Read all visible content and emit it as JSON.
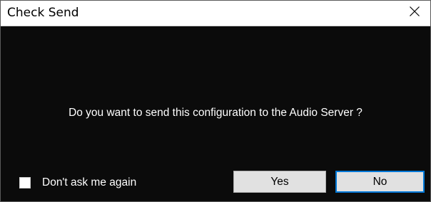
{
  "dialog": {
    "title": "Check Send",
    "close_icon": "close-icon",
    "message": "Do you want to send this configuration to the Audio Server ?",
    "dont_ask_again": {
      "label": "Don't ask me again",
      "checked": false
    },
    "buttons": {
      "yes_label": "Yes",
      "no_label": "No",
      "default": "No"
    }
  },
  "colors": {
    "title_bar": "#ffffff",
    "body_background": "#0b0b0b",
    "text_on_body": "#ffffff",
    "button_face": "#e1e1e1",
    "default_button_border": "#0078d7"
  }
}
